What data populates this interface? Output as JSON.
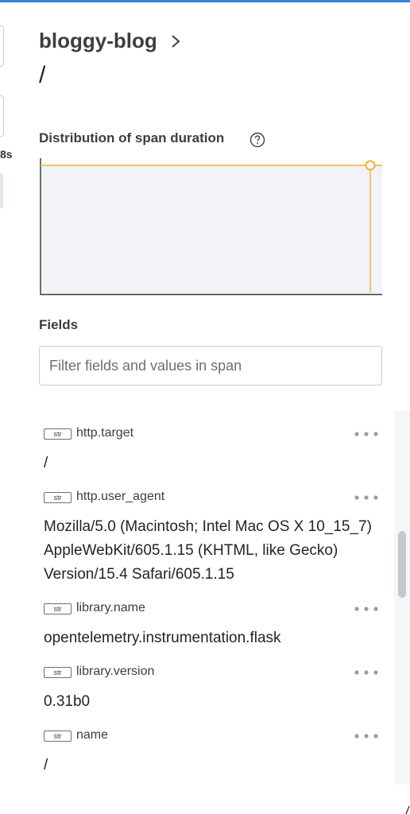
{
  "header": {
    "app_name": "bloggy-blog",
    "path": "/"
  },
  "left_panel": {
    "duration_suffix": "8s"
  },
  "distribution": {
    "label": "Distribution of span duration"
  },
  "fields_section": {
    "label": "Fields",
    "filter_placeholder": "Filter fields and values in span"
  },
  "fields": [
    {
      "type": "str",
      "name": "http.target",
      "value": "/"
    },
    {
      "type": "str",
      "name": "http.user_agent",
      "value_lines": [
        "Mozilla/5.0 (Macintosh; Intel Mac OS X 10_15_7)",
        "AppleWebKit/605.1.15 (KHTML, like Gecko)",
        "Version/15.4 Safari/605.1.15"
      ]
    },
    {
      "type": "str",
      "name": "library.name",
      "value": "opentelemetry.instrumentation.flask"
    },
    {
      "type": "str",
      "name": "library.version",
      "value": "0.31b0"
    },
    {
      "type": "str",
      "name": "name",
      "value": "/"
    }
  ],
  "colors": {
    "accent_top": "#2f86d6",
    "chart_line": "#f2b233",
    "chart_fill": "#f1f3f7"
  },
  "icons": {
    "chevron": "chevron-right-icon",
    "help": "question-circle-icon",
    "more": "more-horizontal-icon"
  }
}
